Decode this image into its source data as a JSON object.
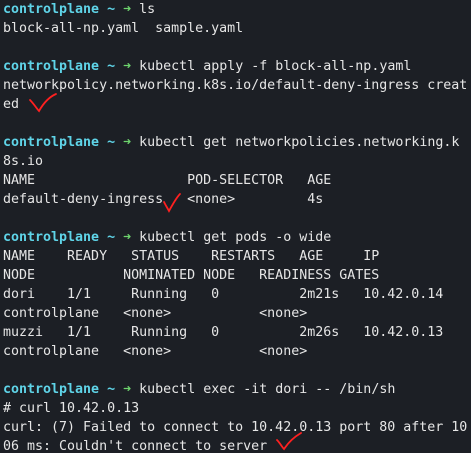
{
  "accent_colors": {
    "background": "#1c1f25",
    "hostname": "#5fd4e8",
    "arrow": "#6dd36d",
    "text": "#e6e6e6",
    "annotation": "#ff2020"
  },
  "prompt": {
    "host": "controlplane",
    "tilde": "~",
    "arrow": "➜"
  },
  "blocks": [
    {
      "command": "ls",
      "output": [
        "block-all-np.yaml  sample.yaml"
      ]
    },
    {
      "command": "kubectl apply -f block-all-np.yaml",
      "output": [
        "networkpolicy.networking.k8s.io/default-deny-ingress creat",
        "ed"
      ]
    },
    {
      "command": "kubectl get networkpolicies.networking.k",
      "output": [
        "8s.io",
        "NAME                   POD-SELECTOR   AGE",
        "default-deny-ingress   <none>         4s"
      ]
    },
    {
      "command": "kubectl get pods -o wide",
      "output": [
        "NAME    READY   STATUS    RESTARTS   AGE     IP",
        "NODE           NOMINATED NODE   READINESS GATES",
        "dori    1/1     Running   0          2m21s   10.42.0.14",
        "controlplane   <none>           <none>",
        "muzzi   1/1     Running   0          2m26s   10.42.0.13",
        "controlplane   <none>           <none>"
      ]
    },
    {
      "command": "kubectl exec -it dori -- /bin/sh",
      "output": [
        "# curl 10.42.0.13",
        "curl: (7) Failed to connect to 10.42.0.13 port 80 after 10",
        "06 ms: Couldn't connect to server"
      ]
    }
  ],
  "annotations": [
    "checkmark-1",
    "checkmark-2",
    "checkmark-3"
  ]
}
